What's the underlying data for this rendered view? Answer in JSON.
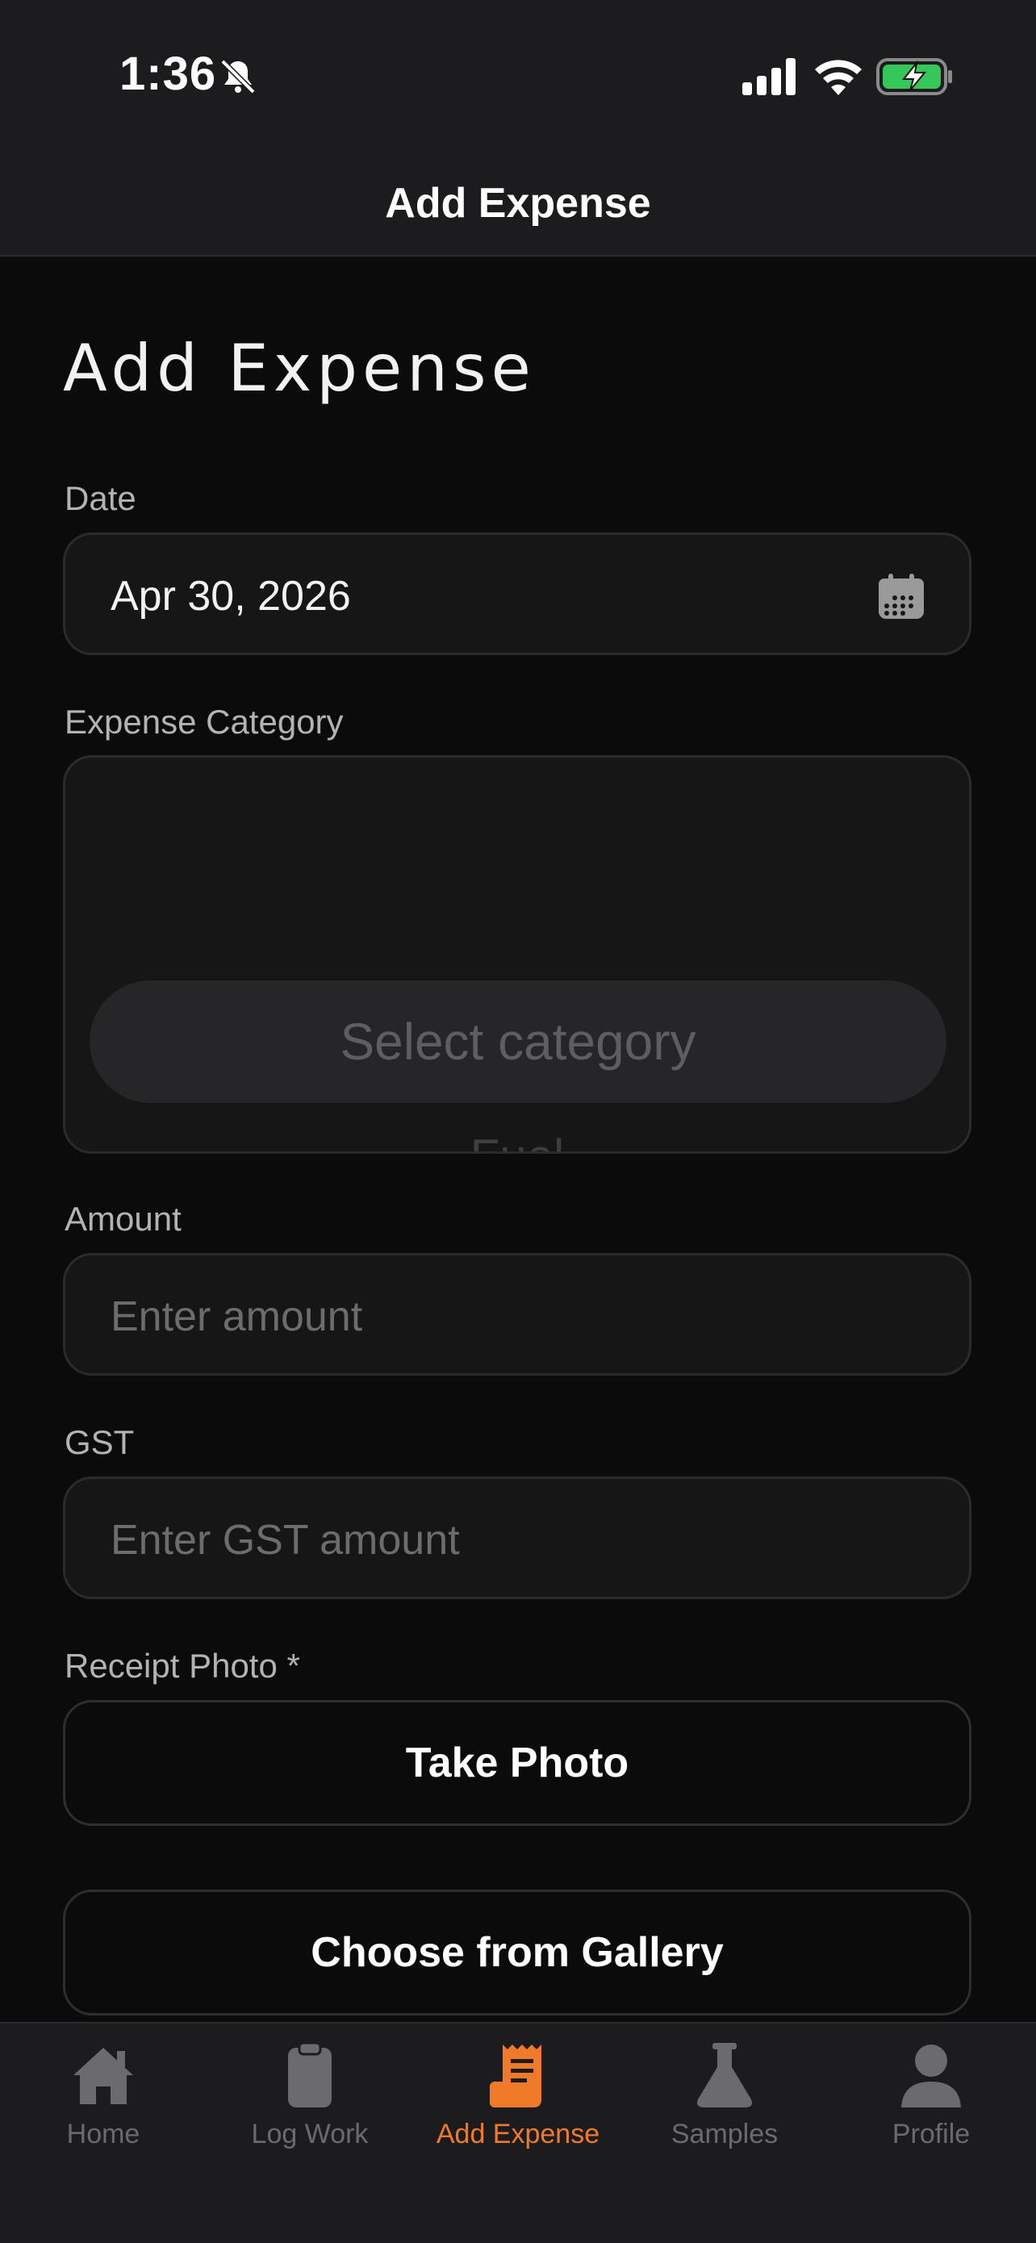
{
  "status_bar": {
    "time": "1:36"
  },
  "header": {
    "title": "Add Expense"
  },
  "page": {
    "heading": "Add Expense"
  },
  "form": {
    "date": {
      "label": "Date",
      "value": "Apr 30, 2026"
    },
    "category": {
      "label": "Expense Category",
      "selected": "Select category",
      "next_option_partial": "Fuel"
    },
    "amount": {
      "label": "Amount",
      "placeholder": "Enter amount"
    },
    "gst": {
      "label": "GST",
      "placeholder": "Enter GST amount"
    },
    "receipt": {
      "label": "Receipt Photo *",
      "take_photo": "Take Photo",
      "gallery": "Choose from Gallery"
    }
  },
  "tabs": [
    {
      "label": "Home",
      "icon": "home-icon",
      "active": false
    },
    {
      "label": "Log Work",
      "icon": "clipboard-icon",
      "active": false
    },
    {
      "label": "Add Expense",
      "icon": "receipt-icon",
      "active": true
    },
    {
      "label": "Samples",
      "icon": "flask-icon",
      "active": false
    },
    {
      "label": "Profile",
      "icon": "person-icon",
      "active": false
    }
  ],
  "colors": {
    "accent": "#f07a2a",
    "background": "#0b0b0b",
    "surface": "#1c1c1e"
  }
}
